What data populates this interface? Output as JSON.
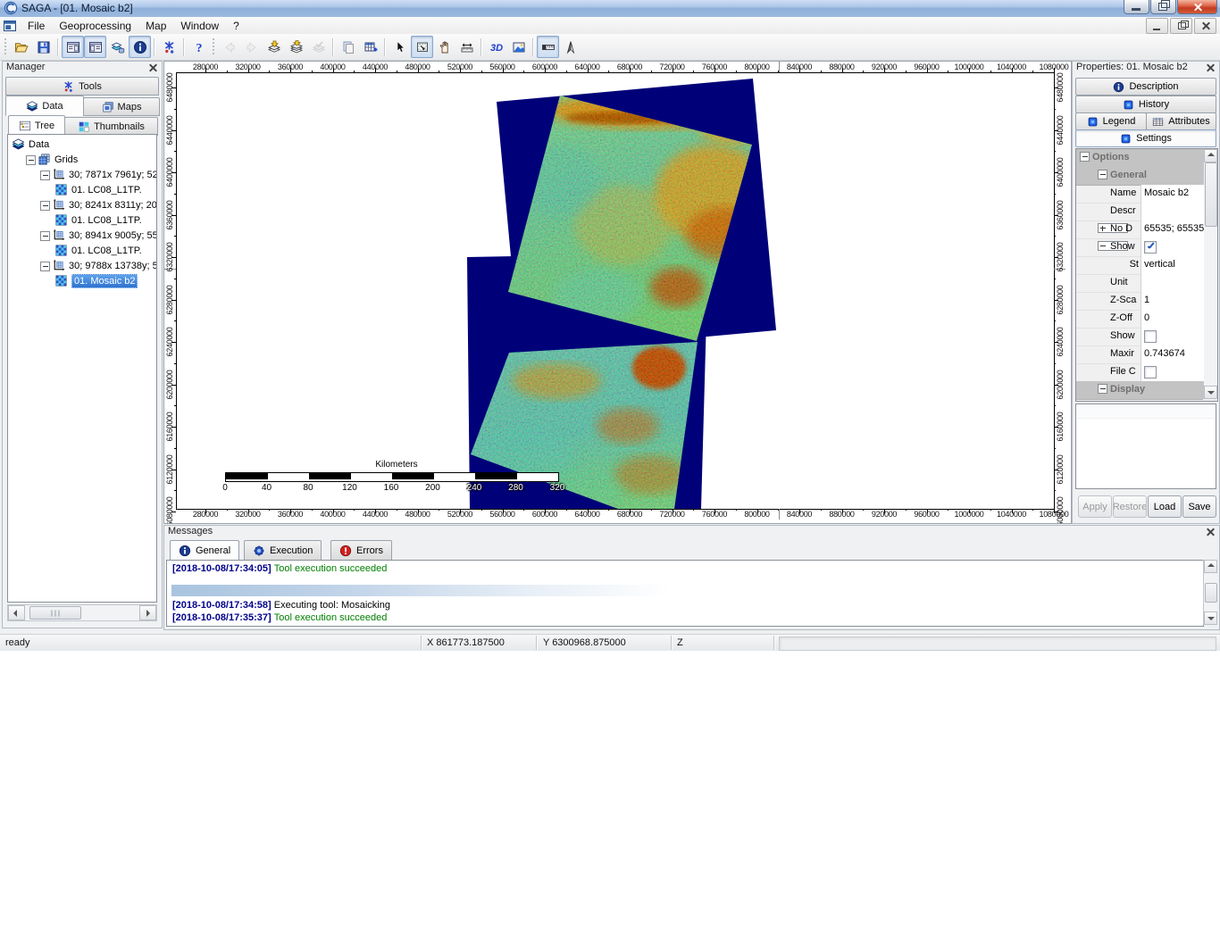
{
  "window": {
    "title": "SAGA - [01. Mosaic b2]"
  },
  "menubar": {
    "items": [
      "File",
      "Geoprocessing",
      "Map",
      "Window",
      "?"
    ]
  },
  "toolbar": {
    "items": [
      {
        "type": "grip"
      },
      {
        "type": "btn",
        "icon": "open"
      },
      {
        "type": "btn",
        "icon": "save"
      },
      {
        "type": "sep"
      },
      {
        "type": "btn",
        "icon": "panel-tree",
        "pressed": true
      },
      {
        "type": "btn",
        "icon": "panel-props",
        "pressed": true
      },
      {
        "type": "btn",
        "icon": "panel-data"
      },
      {
        "type": "btn",
        "icon": "info",
        "pressed": true
      },
      {
        "type": "sep"
      },
      {
        "type": "btn",
        "icon": "tools"
      },
      {
        "type": "sep"
      },
      {
        "type": "btn",
        "icon": "help"
      },
      {
        "type": "grip"
      },
      {
        "type": "btn",
        "icon": "arrow-left",
        "disabled": true
      },
      {
        "type": "btn",
        "icon": "arrow-right",
        "disabled": true
      },
      {
        "type": "btn",
        "icon": "add-grid"
      },
      {
        "type": "btn",
        "icon": "add-grid2"
      },
      {
        "type": "btn",
        "icon": "apply-grid",
        "disabled": true
      },
      {
        "type": "sep"
      },
      {
        "type": "btn",
        "icon": "copy"
      },
      {
        "type": "btn",
        "icon": "grid-table"
      },
      {
        "type": "sep"
      },
      {
        "type": "btn",
        "icon": "cursor"
      },
      {
        "type": "btn",
        "icon": "zoom-rect",
        "pressed": true
      },
      {
        "type": "btn",
        "icon": "pan-hand"
      },
      {
        "type": "btn",
        "icon": "measure"
      },
      {
        "type": "sep"
      },
      {
        "type": "btn",
        "icon": "view-3d"
      },
      {
        "type": "btn",
        "icon": "save-image"
      },
      {
        "type": "sep"
      },
      {
        "type": "btn",
        "icon": "scale-ruler",
        "pressed": true
      },
      {
        "type": "btn",
        "icon": "north-arrow"
      }
    ]
  },
  "manager": {
    "title": "Manager",
    "tab_tools": "Tools",
    "tab_data": "Data",
    "tab_maps": "Maps",
    "tab_tree": "Tree",
    "tab_thumbnails": "Thumbnails",
    "tree": [
      {
        "indent": 0,
        "icon": "datalayers",
        "label": "Data"
      },
      {
        "indent": 1,
        "exp": true,
        "icon": "gridstack",
        "label": "Grids"
      },
      {
        "indent": 2,
        "exp": true,
        "icon": "gridsys",
        "label": "30; 7871x 7961y; 52"
      },
      {
        "indent": 3,
        "icon": "grid",
        "label": "01. LC08_L1TP."
      },
      {
        "indent": 2,
        "exp": true,
        "icon": "gridsys",
        "label": "30; 8241x 8311y; 20"
      },
      {
        "indent": 3,
        "icon": "grid",
        "label": "01. LC08_L1TP."
      },
      {
        "indent": 2,
        "exp": true,
        "icon": "gridsys",
        "label": "30; 8941x 9005y; 55"
      },
      {
        "indent": 3,
        "icon": "grid",
        "label": "01. LC08_L1TP."
      },
      {
        "indent": 2,
        "exp": true,
        "icon": "gridsys",
        "label": "30; 9788x 13738y; 5"
      },
      {
        "indent": 3,
        "icon": "grid",
        "label": "01. Mosaic b2",
        "selected": true
      }
    ]
  },
  "map": {
    "x_ticks": [
      "280000",
      "320000",
      "360000",
      "400000",
      "440000",
      "480000",
      "520000",
      "560000",
      "600000",
      "640000",
      "680000",
      "720000",
      "760000",
      "800000",
      "840000",
      "880000",
      "920000",
      "960000",
      "1000000",
      "1040000",
      "1080000"
    ],
    "y_ticks": [
      "6480000",
      "6440000",
      "6400000",
      "6360000",
      "6320000",
      "6280000",
      "6240000",
      "6200000",
      "6160000",
      "6120000",
      "6080000"
    ],
    "scalebar": {
      "title": "Kilometers",
      "labels": [
        "0",
        "40",
        "80",
        "120",
        "160",
        "200",
        "240",
        "280",
        "320"
      ]
    }
  },
  "properties": {
    "title": "Properties: 01. Mosaic b2",
    "tabs": [
      {
        "label": "Description",
        "icon": "infoc"
      },
      {
        "label": "History",
        "icon": "bluebox"
      },
      {
        "label": "Legend",
        "icon": "bluebox"
      },
      {
        "label": "Attributes",
        "icon": "attr-table"
      },
      {
        "label": "Settings",
        "icon": "bluebox",
        "active": true
      }
    ],
    "rows": [
      {
        "type": "group",
        "level": 0,
        "exp": "minus",
        "label": "Options"
      },
      {
        "type": "group",
        "level": 1,
        "exp": "minus",
        "label": "General"
      },
      {
        "type": "prop",
        "label": "Name",
        "value": "Mosaic b2"
      },
      {
        "type": "prop",
        "label": "Descr",
        "value": ""
      },
      {
        "type": "prop",
        "exp": "plus",
        "label": "No D",
        "value": "65535; 65535"
      },
      {
        "type": "prop",
        "exp": "minus",
        "label": "Show",
        "check": true
      },
      {
        "type": "prop",
        "label": "St",
        "value": "vertical",
        "sub": true
      },
      {
        "type": "prop",
        "label": "Unit",
        "value": ""
      },
      {
        "type": "prop",
        "label": "Z-Sca",
        "value": "1"
      },
      {
        "type": "prop",
        "label": "Z-Off",
        "value": "0"
      },
      {
        "type": "prop",
        "label": "Show",
        "check": false
      },
      {
        "type": "prop",
        "label": "Maxir",
        "value": "0.743674"
      },
      {
        "type": "prop",
        "label": "File C",
        "check": false
      },
      {
        "type": "group",
        "level": 1,
        "exp": "minus",
        "label": "Display"
      }
    ],
    "buttons": [
      {
        "label": "Apply",
        "disabled": true
      },
      {
        "label": "Restore",
        "disabled": true
      },
      {
        "label": "Load"
      },
      {
        "label": "Save"
      }
    ]
  },
  "messages": {
    "title": "Messages",
    "tabs": [
      {
        "label": "General",
        "icon": "infoc",
        "active": true
      },
      {
        "label": "Execution",
        "icon": "execico"
      },
      {
        "label": "Errors",
        "icon": "errico"
      }
    ],
    "lines": [
      {
        "time": "[2018-10-08/17:34:05]",
        "text": "Tool execution succeeded",
        "status": "ok"
      },
      {
        "progress": true
      },
      {
        "time": "[2018-10-08/17:34:58]",
        "text": "Executing tool: Mosaicking",
        "status": "plain"
      },
      {
        "time": "[2018-10-08/17:35:37]",
        "text": "Tool execution succeeded",
        "status": "ok"
      }
    ]
  },
  "statusbar": {
    "ready": "ready",
    "x": "X 861773.187500",
    "y": "Y 6300968.875000",
    "z": "Z"
  }
}
